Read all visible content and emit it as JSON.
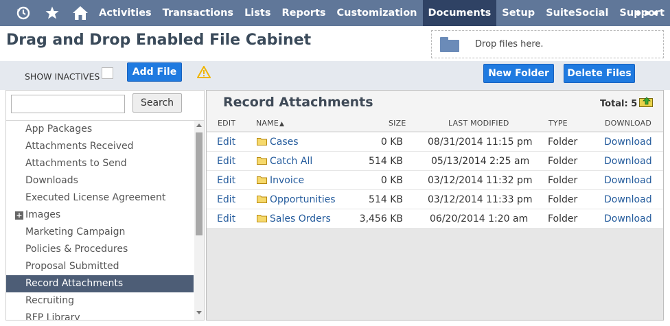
{
  "nav": {
    "icons": [
      "recent-icon",
      "star-icon",
      "home-icon"
    ],
    "items": [
      {
        "label": "Activities"
      },
      {
        "label": "Transactions"
      },
      {
        "label": "Lists"
      },
      {
        "label": "Reports"
      },
      {
        "label": "Customization"
      },
      {
        "label": "Documents",
        "active": true
      },
      {
        "label": "Setup"
      },
      {
        "label": "SuiteSocial"
      },
      {
        "label": "Support"
      }
    ],
    "more": "•••"
  },
  "page": {
    "title": "Drag and Drop Enabled File Cabinet",
    "drop_text": "Drop files here."
  },
  "toolbar": {
    "show_inactives": "SHOW INACTIVES",
    "add_file": "Add File",
    "new_folder": "New Folder",
    "delete_files": "Delete Files"
  },
  "search": {
    "value": "",
    "button": "Search"
  },
  "folders": [
    {
      "label": "App Packages"
    },
    {
      "label": "Attachments Received"
    },
    {
      "label": "Attachments to Send"
    },
    {
      "label": "Downloads"
    },
    {
      "label": "Executed License Agreement"
    },
    {
      "label": "Images",
      "expandable": true
    },
    {
      "label": "Marketing Campaign"
    },
    {
      "label": "Policies & Procedures"
    },
    {
      "label": "Proposal Submitted"
    },
    {
      "label": "Record Attachments",
      "selected": true
    },
    {
      "label": "Recruiting"
    },
    {
      "label": "RFP Library"
    }
  ],
  "content": {
    "title": "Record Attachments",
    "total": "Total: 5",
    "columns": {
      "edit": "EDIT",
      "name": "NAME",
      "sort_arrow": "▲",
      "size": "SIZE",
      "last_modified": "LAST MODIFIED",
      "type": "TYPE",
      "download": "DOWNLOAD"
    },
    "rows": [
      {
        "edit": "Edit",
        "name": "Cases",
        "size": "0 KB",
        "modified": "08/31/2014 11:15 pm",
        "type": "Folder",
        "download": "Download"
      },
      {
        "edit": "Edit",
        "name": "Catch All",
        "size": "514 KB",
        "modified": "05/13/2014 2:25 am",
        "type": "Folder",
        "download": "Download"
      },
      {
        "edit": "Edit",
        "name": "Invoice",
        "size": "0 KB",
        "modified": "03/12/2014 11:32 pm",
        "type": "Folder",
        "download": "Download"
      },
      {
        "edit": "Edit",
        "name": "Opportunities",
        "size": "514 KB",
        "modified": "03/12/2014 11:33 pm",
        "type": "Folder",
        "download": "Download"
      },
      {
        "edit": "Edit",
        "name": "Sales Orders",
        "size": "3,456 KB",
        "modified": "06/20/2014 1:20 am",
        "type": "Folder",
        "download": "Download"
      }
    ]
  },
  "colors": {
    "nav_bg": "#607799",
    "nav_active": "#2f4264",
    "button_blue": "#1f7ae0",
    "link": "#255c9d",
    "selected_row": "#4d5d76",
    "warning": "#f0b400",
    "folder_yellow": "#f2c230"
  }
}
